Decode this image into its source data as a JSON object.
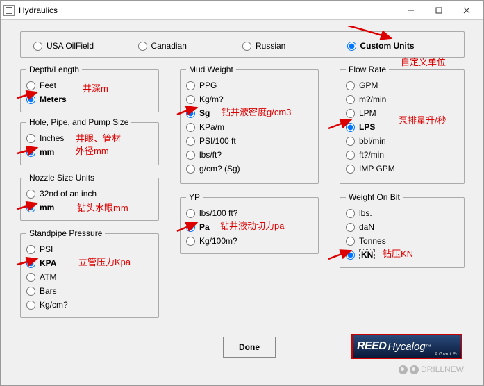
{
  "window": {
    "title": "Hydraulics"
  },
  "locales": {
    "legend": "",
    "opts": [
      "USA OilField",
      "Canadian",
      "Russian",
      "Custom Units"
    ],
    "selected": 3
  },
  "depth": {
    "legend": "Depth/Length",
    "opts": [
      "Feet",
      "Meters"
    ],
    "selected": 1
  },
  "hole": {
    "legend": "Hole, Pipe, and Pump Size",
    "opts": [
      "Inches",
      "mm"
    ],
    "selected": 1
  },
  "nozzle": {
    "legend": "Nozzle Size Units",
    "opts": [
      "32nd of an inch",
      "mm"
    ],
    "selected": 1
  },
  "stand": {
    "legend": "Standpipe Pressure",
    "opts": [
      "PSI",
      "KPA",
      "ATM",
      "Bars",
      "Kg/cm?"
    ],
    "selected": 1
  },
  "mud": {
    "legend": "Mud Weight",
    "opts": [
      "PPG",
      "Kg/m?",
      "Sg",
      "KPa/m",
      "PSI/100 ft",
      "lbs/ft?",
      "g/cm? (Sg)"
    ],
    "selected": 2
  },
  "yp": {
    "legend": "YP",
    "opts": [
      "lbs/100 ft?",
      "Pa",
      "Kg/100m?"
    ],
    "selected": 1
  },
  "flow": {
    "legend": "Flow Rate",
    "opts": [
      "GPM",
      "m?/min",
      "LPM",
      "LPS",
      "bbl/min",
      "ft?/min",
      "IMP GPM"
    ],
    "selected": 3
  },
  "wob": {
    "legend": "Weight On Bit",
    "opts": [
      "lbs.",
      "daN",
      "Tonnes",
      "KN"
    ],
    "selected": 3
  },
  "done_label": "Done",
  "annotations": {
    "custom": "自定义单位",
    "depth": "井深m",
    "hole1": "井眼、管材",
    "hole2": "外径mm",
    "nozzle": "钻头水眼mm",
    "stand": "立管压力Kpa",
    "mud": "钻井液密度g/cm3",
    "yp": "钻井液动切力pa",
    "flow": "泵排量升/秒",
    "wob": "钻压KN"
  },
  "logo": {
    "brand1": "REED",
    "brand2": "Hycalog",
    "sub": "A Grant Pri"
  },
  "watermark": "DRILLNEW"
}
